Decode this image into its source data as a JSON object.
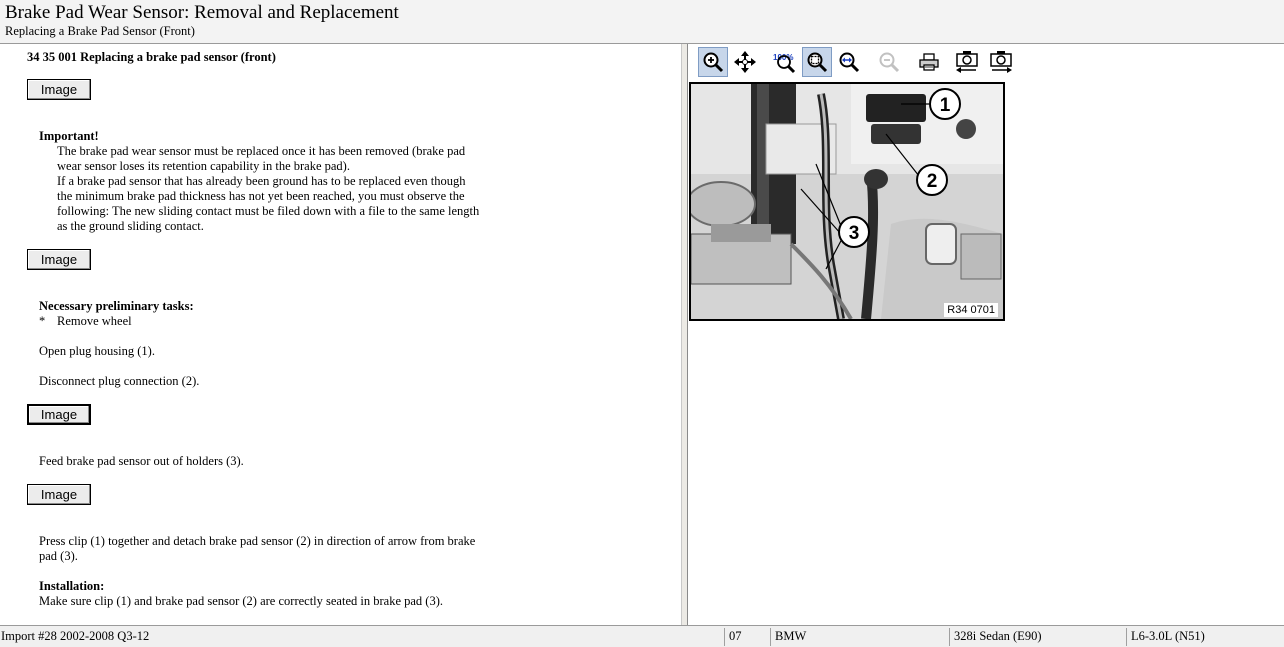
{
  "header": {
    "title": "Brake Pad Wear Sensor:  Removal and Replacement",
    "subtitle": "Replacing a Brake Pad Sensor (Front)"
  },
  "document": {
    "heading": "34 35 001 Replacing a brake pad sensor (front)",
    "image_button_label": "Image",
    "important_label": "Important!",
    "important_lines": [
      "The brake pad wear sensor must be replaced once it has been removed (brake pad",
      "wear sensor loses its retention capability in the brake pad).",
      "If a brake pad sensor that has already been ground has to be replaced even though",
      "the minimum brake pad thickness has not yet been reached, you must observe the",
      "following: The new sliding contact must be filed down with a file to the same length",
      "as the ground sliding contact."
    ],
    "preliminary_label": "Necessary preliminary tasks:",
    "preliminary_bullet": "*",
    "preliminary_item": "Remove wheel",
    "step_open_plug": "Open plug housing (1).",
    "step_disconnect": "Disconnect plug connection (2).",
    "step_feed": "Feed brake pad sensor out of holders (3).",
    "step_press_line1": "Press clip (1) together and detach brake pad sensor (2) in direction of arrow from brake",
    "step_press_line2": "pad (3).",
    "installation_label": "Installation:",
    "installation_text": "Make sure clip (1) and brake pad sensor (2) are correctly seated in brake pad (3)."
  },
  "toolbar": {
    "buttons": [
      {
        "name": "zoom-in",
        "icon": "zoom-in-icon",
        "active": true
      },
      {
        "name": "pan",
        "icon": "move-arrows-icon",
        "active": false
      },
      {
        "name": "zoom-100",
        "icon": "zoom-100-icon",
        "active": false,
        "label": "100%"
      },
      {
        "name": "zoom-fit",
        "icon": "zoom-fit-icon",
        "active": true
      },
      {
        "name": "zoom-width",
        "icon": "zoom-width-icon",
        "active": false
      },
      {
        "name": "zoom-out",
        "icon": "zoom-out-icon",
        "active": false,
        "disabled": true
      },
      {
        "name": "print",
        "icon": "printer-icon",
        "active": false
      },
      {
        "name": "previous-image",
        "icon": "camera-prev-icon",
        "active": false
      },
      {
        "name": "next-image",
        "icon": "camera-next-icon",
        "active": false
      }
    ]
  },
  "figure": {
    "label": "R34 0701",
    "callouts": [
      "1",
      "2",
      "3"
    ]
  },
  "status": {
    "import": "Import #28 2002-2008 Q3-12",
    "code": "07",
    "make": "BMW",
    "model": "328i Sedan (E90)",
    "engine": "L6-3.0L (N51)"
  },
  "colors": {
    "toolbar_active": "#c7d6ea",
    "panel_bg": "#f3f3f3"
  }
}
